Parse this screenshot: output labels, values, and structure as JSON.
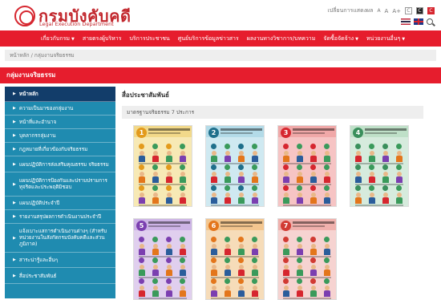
{
  "header": {
    "logo_title": "กรมบังคับคดี",
    "logo_subtitle": "Legal Execution Department",
    "tools": {
      "label": "เปลี่ยนการแสดงผล",
      "font_small": "A",
      "font_medium": "A",
      "font_large": "A+",
      "contrast": [
        "C",
        "C",
        "C"
      ]
    }
  },
  "nav": {
    "items": [
      {
        "label": "เกี่ยวกับกรม",
        "has_caret": true
      },
      {
        "label": "สายตรงผู้บริหาร",
        "has_caret": false
      },
      {
        "label": "บริการประชาชน",
        "has_caret": false
      },
      {
        "label": "ศูนย์บริการข้อมูลข่าวสาร",
        "has_caret": false
      },
      {
        "label": "ผลงานทางวิชาการ/บทความ",
        "has_caret": false
      },
      {
        "label": "จัดซื้อจัดจ้าง",
        "has_caret": true
      },
      {
        "label": "หน่วยงานอื่นๆ",
        "has_caret": true
      }
    ]
  },
  "breadcrumb": "หน้าหลัก  /  กลุ่มงานจริยธรรม",
  "page_title": "กลุ่มงานจริยธรรม",
  "sidebar": {
    "items": [
      {
        "label": "หน้าหลัก",
        "active": true
      },
      {
        "label": "ความเป็นมาของกลุ่มงาน"
      },
      {
        "label": "หน้าที่และอำนาจ"
      },
      {
        "label": "บุคลากรกลุ่มงาน"
      },
      {
        "label": "กฎหมายที่เกี่ยวข้องกับจริยธรรม"
      },
      {
        "label": "แผนปฏิบัติการส่งเสริมคุณธรรม จริยธรรม"
      },
      {
        "label": "แผนปฏิบัติการป้องกันและปราบปรามการทุจริตและประพฤติมิชอบ"
      },
      {
        "label": "แผนปฏิบัติประจำปี"
      },
      {
        "label": "รายงานสรุปผลการดำเนินงานประจำปี"
      },
      {
        "label": "แจ้งเบาะแสการดำเนินงานต่างๆ (สำหรับหน่วยงานในสังกัดกรมบังคับคดีและส่วนภูมิภาค)"
      },
      {
        "label": "สาระน่ารู้และอื่นๆ"
      },
      {
        "label": "สื่อประชาสัมพันธ์"
      }
    ]
  },
  "content": {
    "title": "สื่อประชาสัมพันธ์",
    "subhead": "มาตรฐานจริยธรรม 7 ประการ",
    "posters": [
      {
        "num": "1",
        "bg": "#f7e9b5",
        "band": "#f2d98a",
        "accent": "#e39a1c"
      },
      {
        "num": "2",
        "bg": "#cfe9f1",
        "band": "#b3dbe8",
        "accent": "#1f6f8b"
      },
      {
        "num": "3",
        "bg": "#f6c4c4",
        "band": "#f0a8a8",
        "accent": "#d6262f"
      },
      {
        "num": "4",
        "bg": "#d6ebdd",
        "band": "#bfe0c8",
        "accent": "#3a8f5c"
      },
      {
        "num": "5",
        "bg": "#e0cfee",
        "band": "#cdb4e6",
        "accent": "#7b3fb0"
      },
      {
        "num": "6",
        "bg": "#f6dcb9",
        "band": "#f3c68f",
        "accent": "#e3761c"
      },
      {
        "num": "7",
        "bg": "#f6d3d1",
        "band": "#f0b1ad",
        "accent": "#d13a33"
      }
    ]
  },
  "colors": {
    "brand_red": "#e61d2d",
    "sidebar_blue": "#1f8bb0",
    "sidebar_active": "#123d6a"
  }
}
